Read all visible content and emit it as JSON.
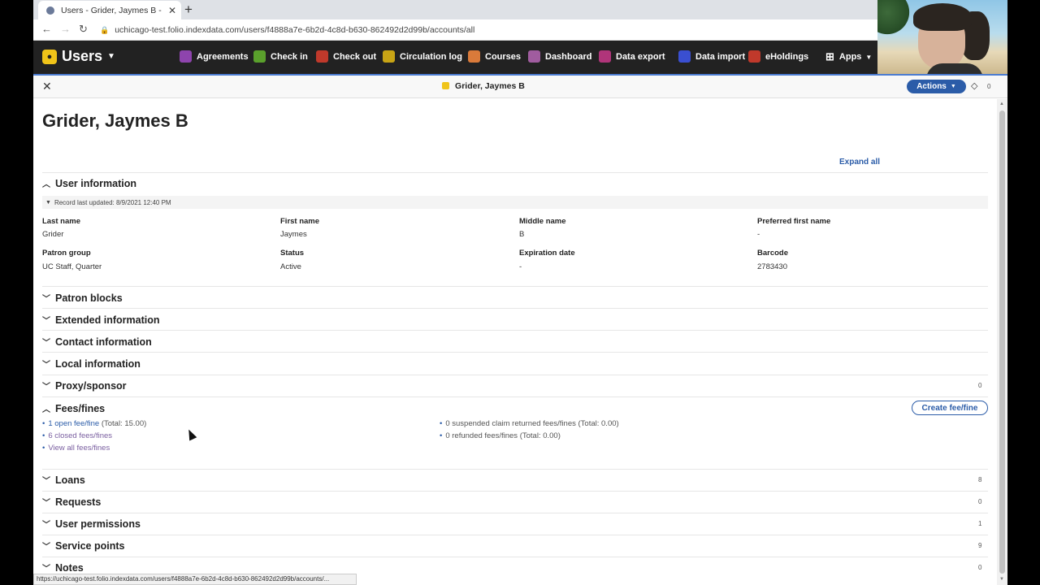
{
  "browser": {
    "tab_title": "Users - Grider, Jaymes B - FOLIO",
    "url": "uchicago-test.folio.indexdata.com/users/f4888a7e-6b2d-4c8d-b630-862492d2d99b/accounts/all",
    "status_url": "https://uchicago-test.folio.indexdata.com/users/f4888a7e-6b2d-4c8d-b630-862492d2d99b/accounts/..."
  },
  "nav": {
    "app_name": "Users",
    "items": [
      {
        "label": "Agreements",
        "color": "#8e44ad"
      },
      {
        "label": "Check in",
        "color": "#5aa02c"
      },
      {
        "label": "Check out",
        "color": "#c0392b"
      },
      {
        "label": "Circulation log",
        "color": "#c8a415"
      },
      {
        "label": "Courses",
        "color": "#d97a3a"
      },
      {
        "label": "Dashboard",
        "color": "#a05c9f"
      },
      {
        "label": "Data export",
        "color": "#b0357a"
      },
      {
        "label": "Data import",
        "color": "#3a4fd1"
      },
      {
        "label": "eHoldings",
        "color": "#c0392b"
      }
    ],
    "apps_label": "Apps"
  },
  "pane": {
    "title": "Grider, Jaymes B",
    "actions_label": "Actions",
    "tag_count": "0"
  },
  "user": {
    "name": "Grider, Jaymes B",
    "expand_all": "Expand all",
    "record_updated": "Record last updated: 8/9/2021 12:40 PM",
    "fields": {
      "last_name_label": "Last name",
      "last_name": "Grider",
      "first_name_label": "First name",
      "first_name": "Jaymes",
      "middle_name_label": "Middle name",
      "middle_name": "B",
      "preferred_label": "Preferred first name",
      "preferred": "-",
      "patron_group_label": "Patron group",
      "patron_group": "UC Staff, Quarter",
      "status_label": "Status",
      "status": "Active",
      "expiration_label": "Expiration date",
      "expiration": "-",
      "barcode_label": "Barcode",
      "barcode": "2783430"
    }
  },
  "sections": {
    "user_information": "User information",
    "patron_blocks": "Patron blocks",
    "extended_information": "Extended information",
    "contact_information": "Contact information",
    "local_information": "Local information",
    "proxy_sponsor": "Proxy/sponsor",
    "proxy_sponsor_count": "0",
    "fees_fines": "Fees/fines",
    "loans": "Loans",
    "loans_count": "8",
    "requests": "Requests",
    "requests_count": "0",
    "user_permissions": "User permissions",
    "user_permissions_count": "1",
    "service_points": "Service points",
    "service_points_count": "9",
    "notes": "Notes",
    "notes_count": "0"
  },
  "fees": {
    "create_label": "Create fee/fine",
    "open_link": "1 open fee/fine",
    "open_total": "(Total: 15.00)",
    "closed_link": "6 closed fees/fines",
    "view_all": "View all fees/fines",
    "suspended": "0 suspended claim returned fees/fines (Total: 0.00)",
    "refunded": "0 refunded fees/fines (Total: 0.00)"
  }
}
